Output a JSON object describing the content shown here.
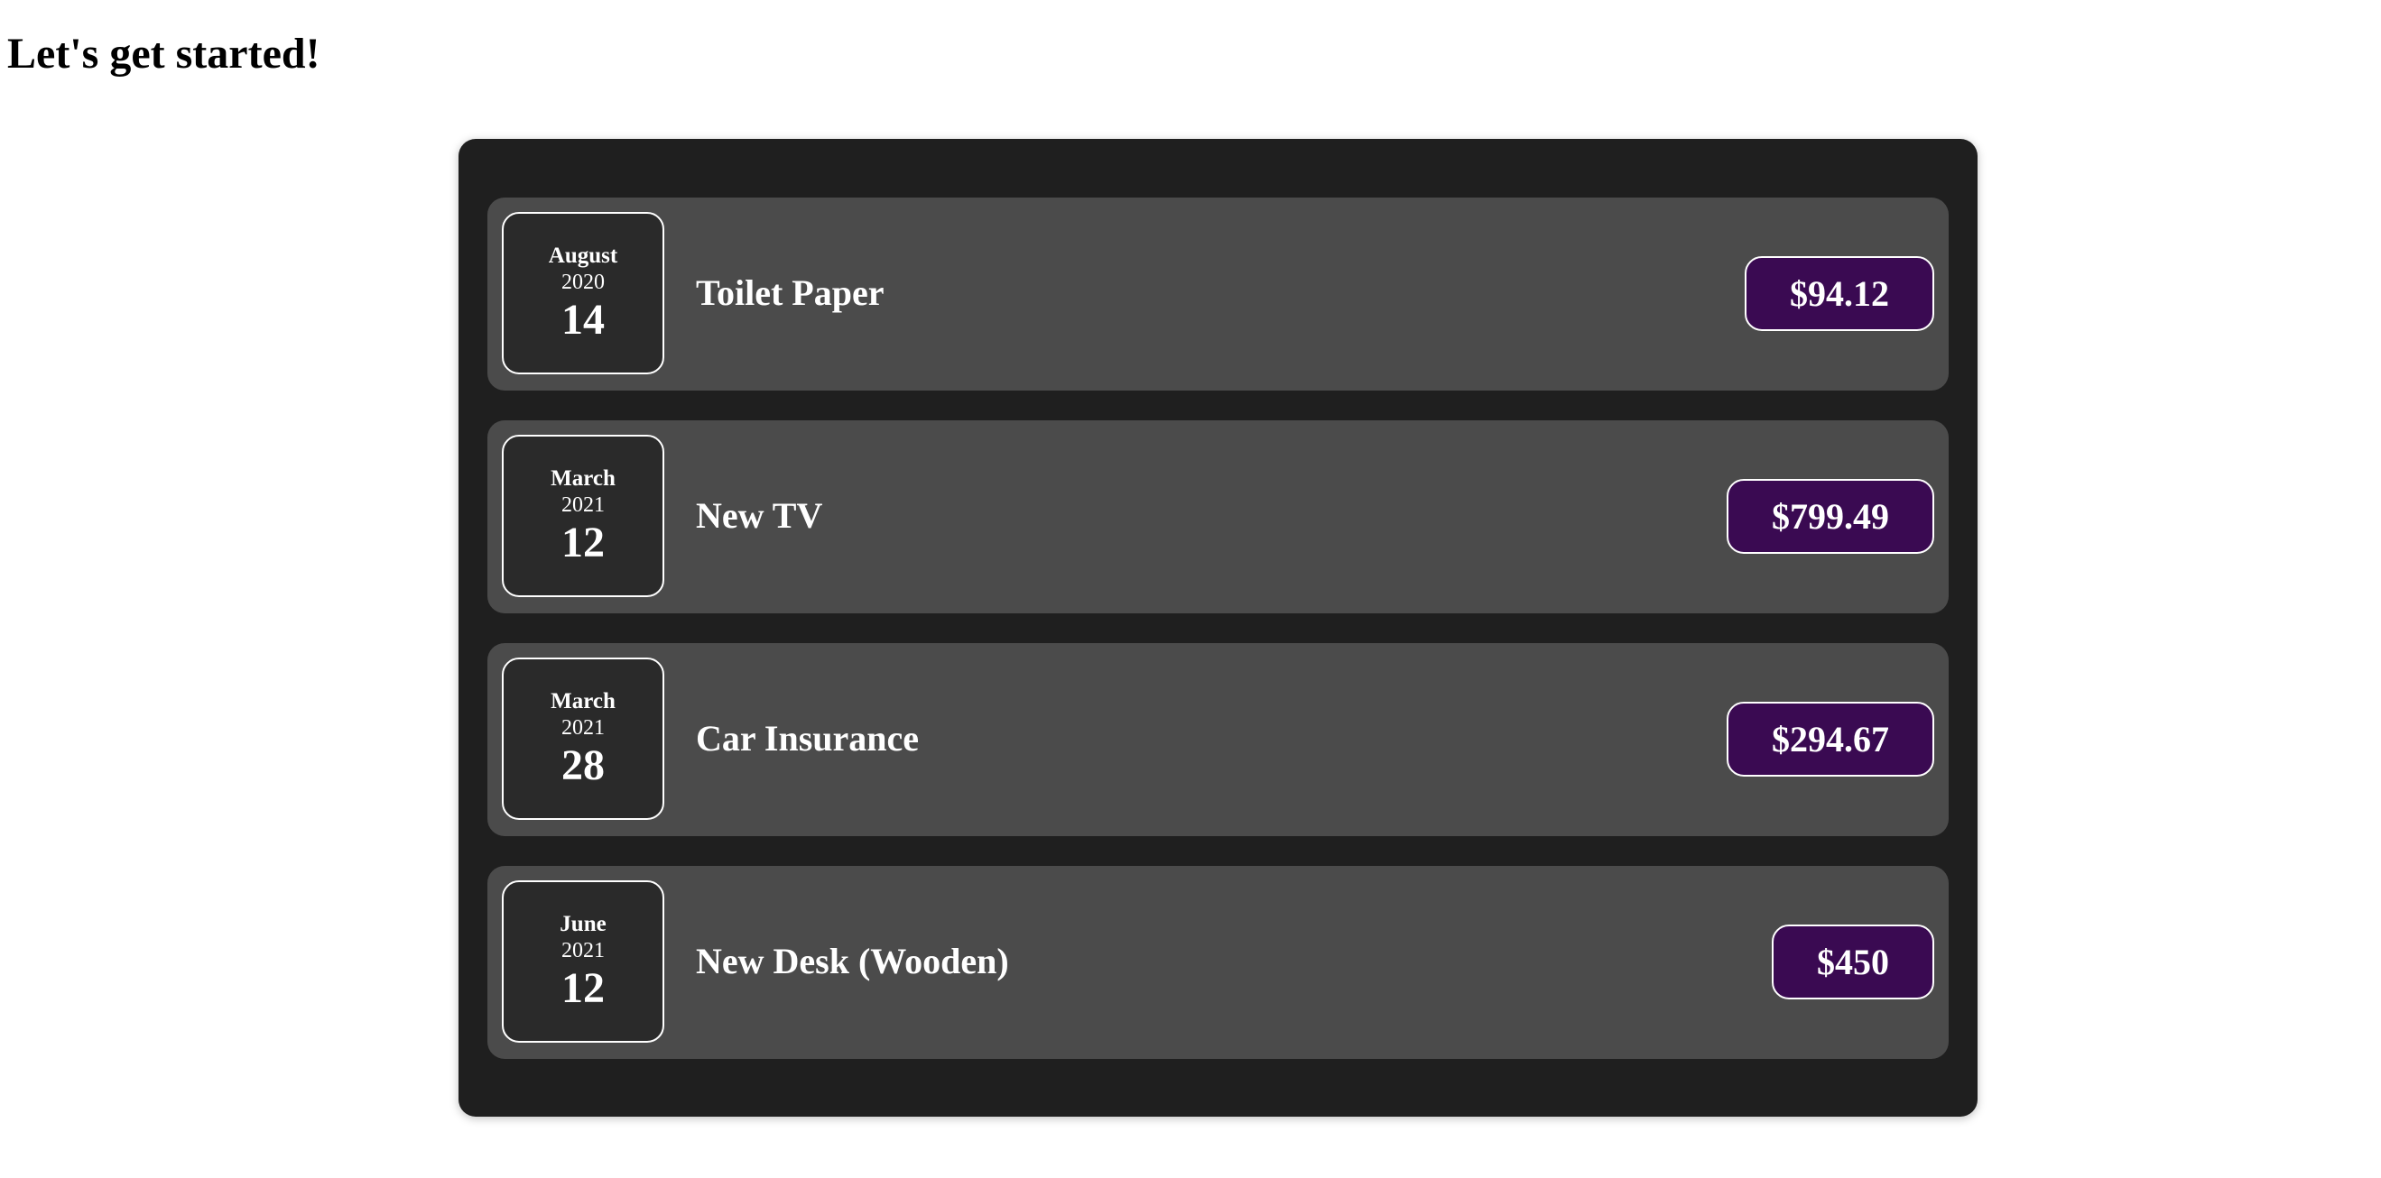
{
  "page": {
    "title": "Let's get started!"
  },
  "colors": {
    "panel_background": "#1f1f1f",
    "item_background": "#4b4b4b",
    "date_box_background": "#2a2a2a",
    "price_background": "#3a0a52",
    "text": "#ffffff"
  },
  "expenses": [
    {
      "month": "August",
      "year": "2020",
      "day": "14",
      "title": "Toilet Paper",
      "amount": "$94.12"
    },
    {
      "month": "March",
      "year": "2021",
      "day": "12",
      "title": "New TV",
      "amount": "$799.49"
    },
    {
      "month": "March",
      "year": "2021",
      "day": "28",
      "title": "Car Insurance",
      "amount": "$294.67"
    },
    {
      "month": "June",
      "year": "2021",
      "day": "12",
      "title": "New Desk (Wooden)",
      "amount": "$450"
    }
  ]
}
